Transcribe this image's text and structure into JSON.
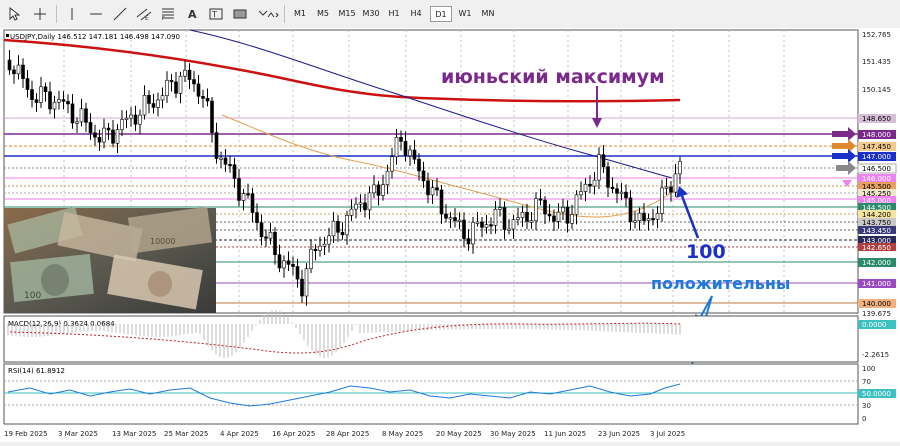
{
  "toolbar": {
    "icons": [
      "cursor-icon",
      "crosshair-icon",
      "vertical-line-icon",
      "horizontal-line-icon",
      "trendline-icon",
      "equidistant-channel-icon",
      "fibonacci-icon",
      "text-icon",
      "label-icon",
      "rectangle-icon",
      "shapes-icon"
    ],
    "timeframes": [
      "M1",
      "M5",
      "M15",
      "M30",
      "H1",
      "H4",
      "D1",
      "W1",
      "MN"
    ],
    "active_timeframe": "D1"
  },
  "chart": {
    "header": "USDJPY,Daily  146.512 147.181 146.498 147.090",
    "price_labels": [
      "152.765",
      "151.435",
      "150.145",
      "148.650",
      "148.000",
      "147.450",
      "147.000",
      "146.500",
      "146.000",
      "145.500",
      "145.250",
      "145.000",
      "144.500",
      "144.200",
      "143.750",
      "143.450",
      "143.000",
      "142.650",
      "142.000",
      "141.000",
      "140.000",
      "139.675"
    ],
    "date_labels": [
      "19 Feb 2025",
      "3 Mar 2025",
      "13 Mar 2025",
      "25 Mar 2025",
      "4 Apr 2025",
      "16 Apr 2025",
      "28 Apr 2025",
      "8 May 2025",
      "20 May 2025",
      "30 May 2025",
      "11 Jun 2025",
      "23 Jun 2025",
      "3 Jul 2025"
    ],
    "annotation_max": "июньский максимум",
    "annotation_100": "100",
    "annotation_pos": "положительны"
  },
  "macd": {
    "label": "MACD(12,26,9) 0.3624 0.0684",
    "scale": [
      "0.0000",
      "-2.2615"
    ]
  },
  "rsi": {
    "label": "RSI(14) 61.8912",
    "scale": [
      "100",
      "70",
      "50.0000",
      "30",
      "0"
    ]
  },
  "colors": {
    "bull": "#000000",
    "ma_red": "#cc1111",
    "ma_blue": "#1a1a8c",
    "ma_orange": "#e0a050",
    "annotation_purple": "#7b2a8c",
    "annotation_blue": "#1a30c8",
    "annotation_light_blue": "#1e7ad8"
  }
}
